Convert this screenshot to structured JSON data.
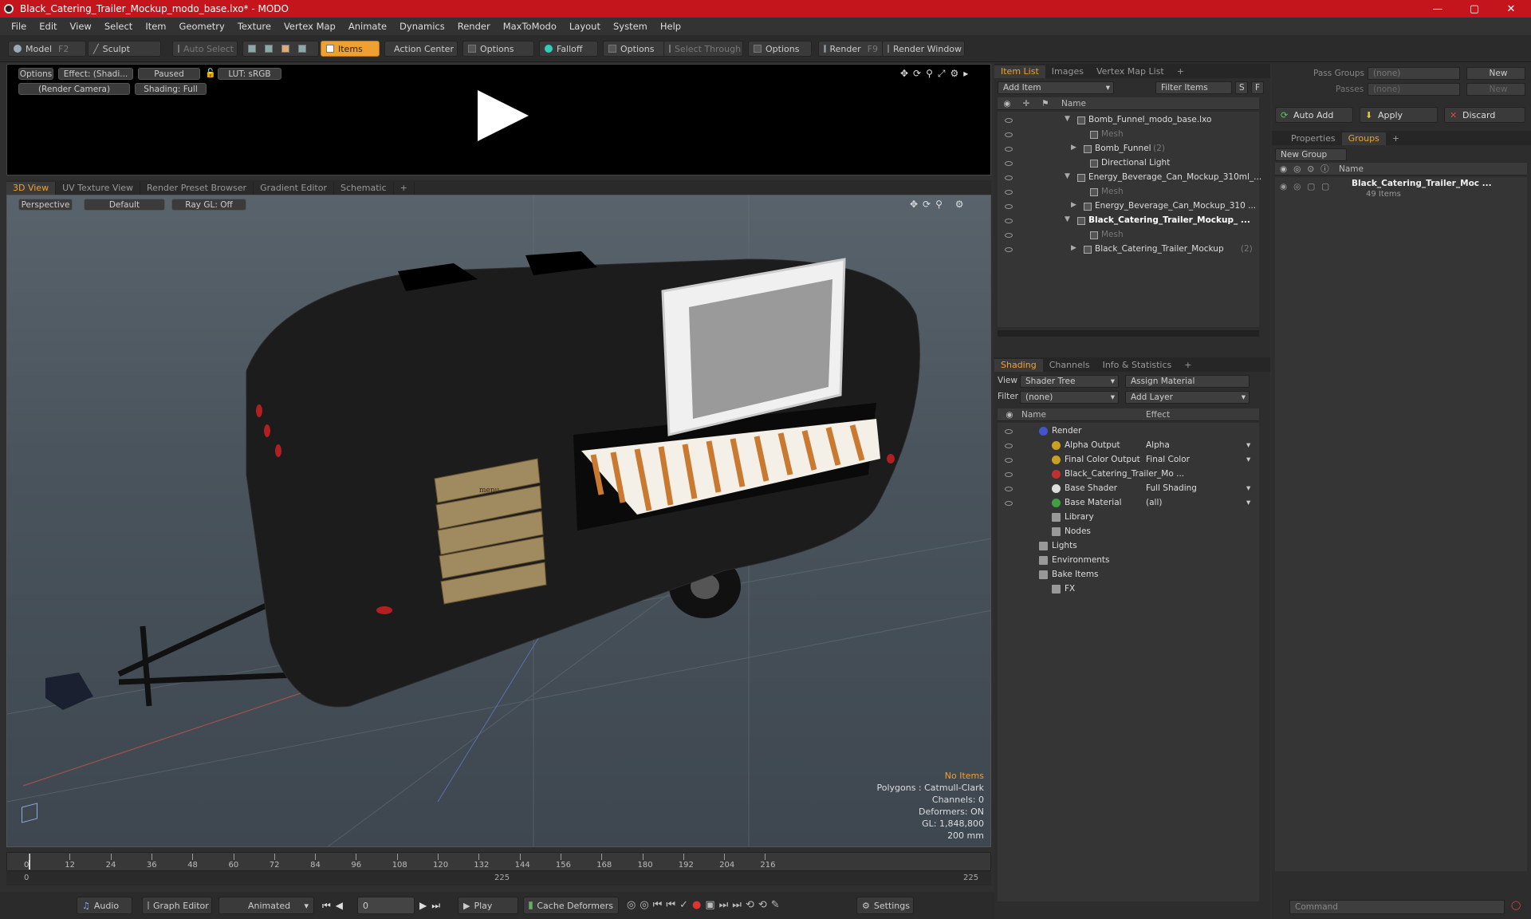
{
  "window": {
    "title": "Black_Catering_Trailer_Mockup_modo_base.lxo* - MODO",
    "min": "—",
    "max": "▢",
    "close": "✕"
  },
  "menu": [
    "File",
    "Edit",
    "View",
    "Select",
    "Item",
    "Geometry",
    "Texture",
    "Vertex Map",
    "Animate",
    "Dynamics",
    "Render",
    "MaxToModo",
    "Layout",
    "System",
    "Help"
  ],
  "toolbar": {
    "model": "Model",
    "model_key": "F2",
    "sculpt": "Sculpt",
    "auto_select": "Auto Select",
    "items": "Items",
    "action_center": "Action Center",
    "options": "Options",
    "falloff": "Falloff",
    "select_through": "Select Through",
    "render": "Render",
    "render_key": "F9",
    "render_window": "Render Window"
  },
  "preview": {
    "options": "Options",
    "effect": "Effect: (Shadi...",
    "paused": "Paused",
    "lut": "LUT: sRGB",
    "camera": "(Render Camera)",
    "shading": "Shading: Full"
  },
  "viewtabs": [
    "3D View",
    "UV Texture View",
    "Render Preset Browser",
    "Gradient Editor",
    "Schematic",
    "+"
  ],
  "viewport": {
    "mode": "Perspective",
    "style": "Default",
    "raygl": "Ray GL: Off",
    "info": {
      "items": "No Items",
      "polygons": "Polygons : Catmull-Clark",
      "channels": "Channels: 0",
      "deformers": "Deformers: ON",
      "gl": "GL: 1,848,800",
      "scale": "200 mm"
    },
    "menu_sign": "menu"
  },
  "timeline": {
    "ticks": [
      "0",
      "12",
      "24",
      "36",
      "48",
      "60",
      "72",
      "84",
      "96",
      "108",
      "120",
      "132",
      "144",
      "156",
      "168",
      "180",
      "192",
      "204",
      "216"
    ],
    "start": "0",
    "mid": "225",
    "end": "225"
  },
  "bottom": {
    "audio": "Audio",
    "graph_editor": "Graph Editor",
    "animated": "Animated",
    "frame": "0",
    "play": "Play",
    "cache": "Cache Deformers",
    "settings": "Settings"
  },
  "itemlist": {
    "tabs": [
      "Item List",
      "Images",
      "Vertex Map List",
      "+"
    ],
    "add_item": "Add Item",
    "filter": "Filter Items",
    "s": "S",
    "f": "F",
    "col_name": "Name",
    "rows": [
      {
        "label": "Bomb_Funnel_modo_base.lxo",
        "indent": 0
      },
      {
        "label": "Mesh",
        "indent": 2,
        "dim": true
      },
      {
        "label": "Bomb_Funnel",
        "count": "(2)",
        "indent": 1
      },
      {
        "label": "Directional Light",
        "indent": 2
      },
      {
        "label": "Energy_Beverage_Can_Mockup_310ml_...",
        "indent": 0
      },
      {
        "label": "Mesh",
        "indent": 2,
        "dim": true
      },
      {
        "label": "Energy_Beverage_Can_Mockup_310 ...",
        "indent": 1
      },
      {
        "label": "Black_Catering_Trailer_Mockup_ ...",
        "indent": 0,
        "bold": true
      },
      {
        "label": "Mesh",
        "indent": 2,
        "dim": true
      },
      {
        "label": "Black_Catering_Trailer_Mockup",
        "count": "(2)",
        "indent": 1
      }
    ]
  },
  "shading": {
    "tabs": [
      "Shading",
      "Channels",
      "Info & Statistics",
      "+"
    ],
    "view_label": "View",
    "view": "Shader Tree",
    "assign": "Assign Material",
    "filter_label": "Filter",
    "filter": "(none)",
    "add_layer": "Add Layer",
    "col_name": "Name",
    "col_effect": "Effect",
    "rows": [
      {
        "label": "Render",
        "effect": ""
      },
      {
        "label": "Alpha Output",
        "effect": "Alpha"
      },
      {
        "label": "Final Color Output",
        "effect": "Final Color"
      },
      {
        "label": "Black_Catering_Trailer_Mo ...",
        "effect": ""
      },
      {
        "label": "Base Shader",
        "effect": "Full Shading"
      },
      {
        "label": "Base Material",
        "effect": "(all)"
      },
      {
        "label": "Library",
        "effect": ""
      },
      {
        "label": "Nodes",
        "effect": ""
      },
      {
        "label": "Lights",
        "effect": ""
      },
      {
        "label": "Environments",
        "effect": ""
      },
      {
        "label": "Bake Items",
        "effect": ""
      },
      {
        "label": "FX",
        "effect": ""
      }
    ]
  },
  "groups": {
    "pass_groups": "Pass Groups",
    "passes": "Passes",
    "none": "(none)",
    "new": "New",
    "auto_add": "Auto Add",
    "apply": "Apply",
    "discard": "Discard",
    "tabs": [
      "Properties",
      "Groups",
      "+"
    ],
    "new_group": "New Group",
    "col_name": "Name",
    "item": "Black_Catering_Trailer_Moc ...",
    "item_count": "49 Items"
  },
  "command": {
    "placeholder": "Command"
  },
  "colors": {
    "accent": "#f0a030",
    "titlebar": "#c4141c"
  }
}
